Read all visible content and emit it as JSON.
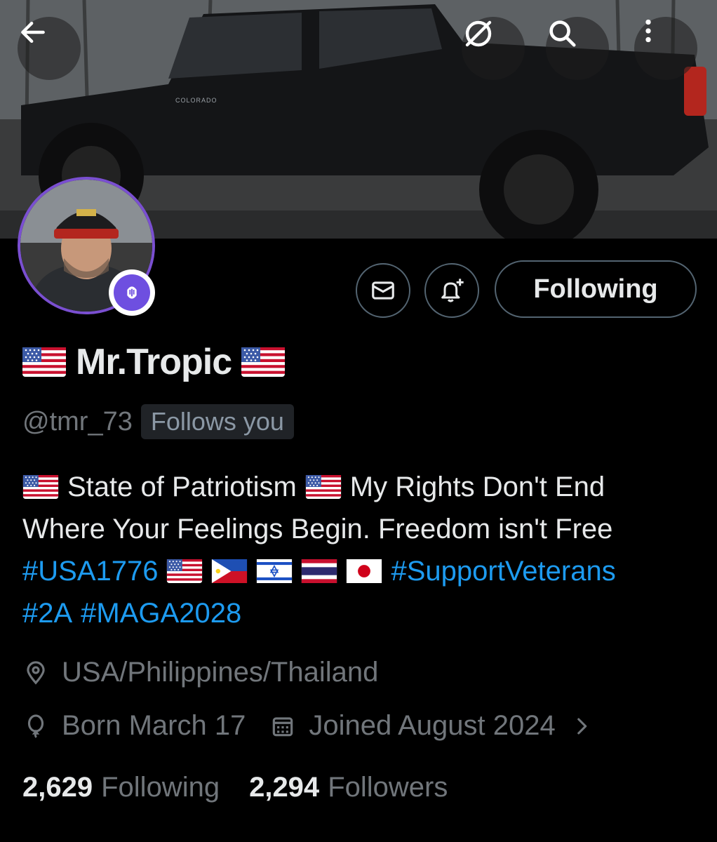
{
  "header": {
    "back_icon": "arrow-left-icon",
    "grok_icon": "slashed-circle-icon",
    "search_icon": "search-icon",
    "more_icon": "more-vertical-icon",
    "banner_vehicle_badge": "COLORADO"
  },
  "profile": {
    "display_name": "Mr.Tropic",
    "name_flag_left": "us-flag",
    "name_flag_right": "us-flag",
    "handle": "@tmr_73",
    "follows_you": "Follows you",
    "spaces_badge_icon": "spaces-mic-icon"
  },
  "actions": {
    "message_icon": "envelope-icon",
    "notify_icon": "bell-plus-icon",
    "follow_label": "Following"
  },
  "bio": {
    "line1_text_a": "State of Patriotism",
    "line1_text_b": "My Rights Don't End",
    "line2_text": "Where Your Feelings Begin. Freedom isn't Free",
    "hashtag_usa": "#USA1776",
    "line3_flags": [
      "us-flag",
      "philippines-flag",
      "israel-flag",
      "thailand-flag",
      "japan-flag"
    ],
    "hashtag_veterans": "#SupportVeterans",
    "hashtag_2a": "#2A",
    "hashtag_maga": "#MAGA2028"
  },
  "meta": {
    "location": "USA/Philippines/Thailand",
    "birthday": "Born March 17",
    "joined": "Joined August 2024"
  },
  "stats": {
    "following_count": "2,629",
    "following_label": "Following",
    "followers_count": "2,294",
    "followers_label": "Followers"
  },
  "colors": {
    "background": "#000000",
    "text_primary": "#e7e9ea",
    "text_secondary": "#71767b",
    "link": "#1d9bf0",
    "avatar_ring": "#7a4fd1",
    "spaces_badge": "#6e4fe0"
  }
}
